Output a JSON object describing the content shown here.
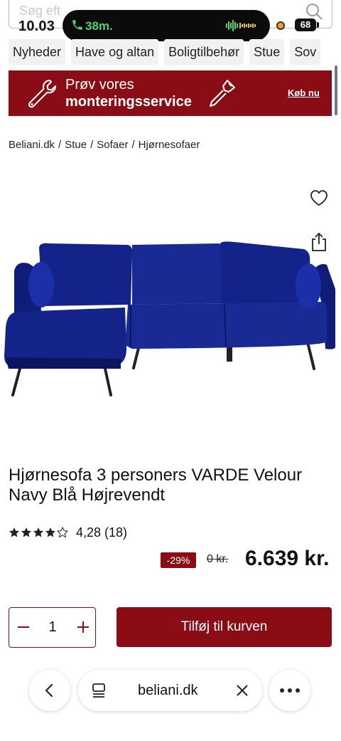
{
  "status": {
    "time": "10.03",
    "call_duration": "38m.",
    "battery": "68"
  },
  "search": {
    "placeholder": "Søg eft"
  },
  "categories": [
    "Nyheder",
    "Have og altan",
    "Boligtilbehør",
    "Stue",
    "Sov"
  ],
  "banner": {
    "line1": "Prøv vores",
    "line2": "monteringsservice",
    "cta": "Køb nu"
  },
  "breadcrumb": [
    "Beliani.dk",
    "Stue",
    "Sofaer",
    "Hjørnesofaer"
  ],
  "breadcrumb_separator": "/",
  "product": {
    "title": "Hjørnesofa 3 personers VARDE Velour Navy Blå Højrevendt",
    "rating_value": 4.28,
    "rating_text": "4,28 (18)",
    "discount": "-29%",
    "old_price": "0 kr.",
    "price": "6.639 kr.",
    "quantity": "1",
    "add_to_cart": "Tilføj til kurven",
    "sofa_color": "#14238a"
  },
  "browser": {
    "url": "beliani.dk"
  },
  "colors": {
    "brand": "#8a0d15",
    "call_green": "#52d26a"
  }
}
